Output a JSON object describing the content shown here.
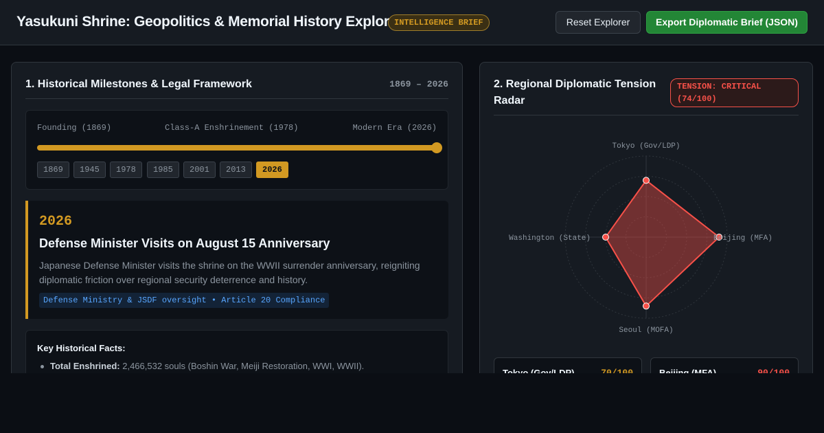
{
  "header": {
    "title": "Yasukuni Shrine: Geopolitics & Memorial History Explorer",
    "badge": "INTELLIGENCE BRIEF",
    "reset_label": "Reset Explorer",
    "export_label": "Export Diplomatic Brief (JSON)"
  },
  "history": {
    "title": "1. Historical Milestones & Legal Framework",
    "range": "1869 – 2026",
    "timeline": {
      "start_label": "Founding (1869)",
      "mid_label": "Class-A Enshrinement (1978)",
      "end_label": "Modern Era (2026)",
      "slider_progress_pct": 100,
      "years": [
        "1869",
        "1945",
        "1978",
        "1985",
        "2001",
        "2013",
        "2026"
      ],
      "selected_year": "2026"
    },
    "event": {
      "year": "2026",
      "title": "Defense Minister Visits on August 15 Anniversary",
      "description": "Japanese Defense Minister visits the shrine on the WWII surrender anniversary, reigniting diplomatic friction over regional security deterrence and history.",
      "tag": "Defense Ministry & JSDF oversight • Article 20 Compliance"
    },
    "facts": {
      "title": "Key Historical Facts:",
      "items": [
        {
          "label": "Total Enshrined:",
          "text": " 2,466,532 souls (Boshin War, Meiji Restoration, WWI, WWII)."
        }
      ]
    }
  },
  "radar": {
    "title_line1": "2. Regional Diplomatic Tension",
    "title_line2": "Radar",
    "tension_line1": "TENSION: CRITICAL",
    "tension_line2": "(74/100)",
    "axes": [
      {
        "name": "Tokyo (Gov/LDP)",
        "value": 70
      },
      {
        "name": "Beijing (MFA)",
        "value": 90
      },
      {
        "name": "Seoul (MOFA)",
        "value": 85
      },
      {
        "name": "Washington (State)",
        "value": 50
      }
    ],
    "max": 100,
    "colors": {
      "fill": "#f85149",
      "grid": "#30363d"
    },
    "cards": [
      {
        "name": "Tokyo (Gov/LDP)",
        "score": "70/100",
        "color": "#d29922"
      },
      {
        "name": "Beijing (MFA)",
        "score": "90/100",
        "color": "#f85149"
      }
    ]
  }
}
